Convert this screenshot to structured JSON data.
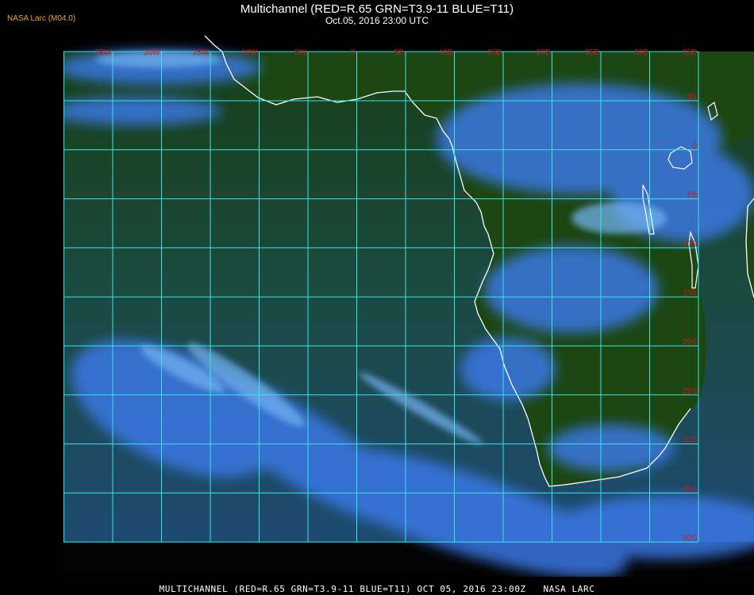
{
  "header": {
    "title": "Multichannel (RED=R.65 GRN=T3.9-11 BLUE=T11)",
    "datetime": "Oct.05, 2016 23:00 UTC",
    "agency_tag": "NASA Larc (M04.0)"
  },
  "map": {
    "lon_labels": [
      "25W",
      "20W",
      "15W",
      "10W",
      "5W",
      "0",
      "5E",
      "10E",
      "15E",
      "20E",
      "25E",
      "30E",
      "35E"
    ],
    "lat_labels": [
      "5N",
      "0",
      "5S",
      "10S",
      "15S",
      "20S",
      "25S",
      "30S",
      "35S",
      "40S"
    ],
    "colors": {
      "grid": "#37e6e6",
      "label": "#d01818",
      "coast": "#ffffff",
      "ocean": "#1d4a52",
      "land": "#1d4a12",
      "cloud": "#3b7ae8"
    }
  },
  "footer": {
    "caption": "MULTICHANNEL (RED=R.65 GRN=T3.9-11 BLUE=T11) OCT 05, 2016 23:00Z   NASA LARC"
  }
}
